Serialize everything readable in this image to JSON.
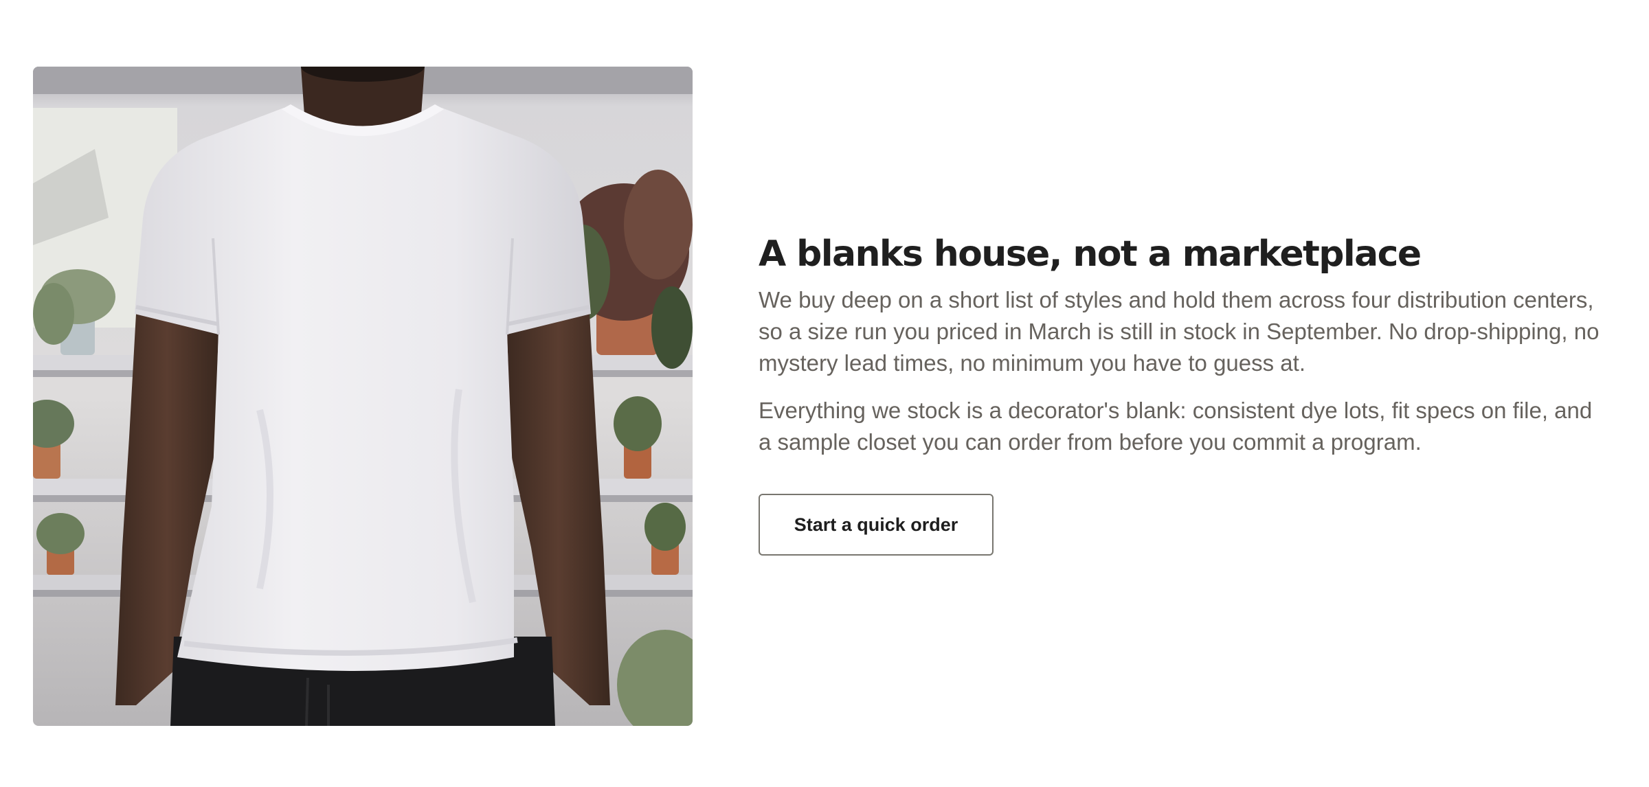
{
  "feature": {
    "image_alt": "Person wearing a plain white t-shirt",
    "title": "A blanks house, not a marketplace",
    "paragraphs": [
      "We buy deep on a short list of styles and hold them across four distribution centers, so a size run you priced in March is still in stock in September. No drop-shipping, no mystery lead times, no minimum you have to guess at.",
      "Everything we stock is a decorator's blank: consistent dye lots, fit specs on file, and a sample closet you can order from before you commit a program."
    ],
    "cta_label": "Start a quick order"
  },
  "colors": {
    "title": "#1f1f1f",
    "body_text": "#66625d",
    "button_border": "#78766f",
    "background": "#ffffff"
  }
}
